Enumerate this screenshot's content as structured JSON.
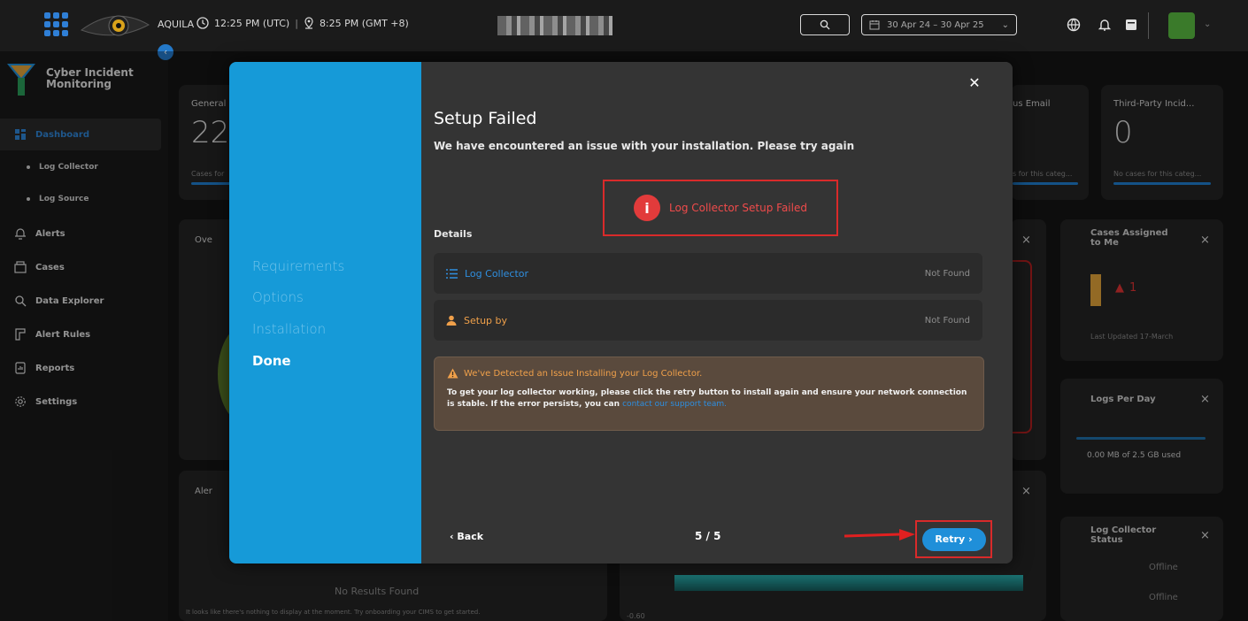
{
  "topbar": {
    "brand": "AQUILA",
    "time_utc": "12:25 PM (UTC)",
    "time_local": "8:25 PM (GMT +8)",
    "date_range": "30 Apr 24 – 30 Apr 25"
  },
  "sidebar": {
    "app_name_line1": "Cyber Incident",
    "app_name_line2": "Monitoring",
    "items": [
      {
        "label": "Dashboard"
      },
      {
        "label": "Log Collector"
      },
      {
        "label": "Log Source"
      },
      {
        "label": "Alerts"
      },
      {
        "label": "Cases"
      },
      {
        "label": "Data Explorer"
      },
      {
        "label": "Alert Rules"
      },
      {
        "label": "Reports"
      },
      {
        "label": "Settings"
      }
    ]
  },
  "dashboard": {
    "general_title": "General",
    "general_value": "22",
    "general_caption": "Cases for",
    "email_title": "us Email",
    "email_caption": "s for this categ...",
    "third_party_title": "Third-Party Incid...",
    "third_party_value": "0",
    "third_party_caption": "No cases for this categ...",
    "overview_title": "Ove",
    "cases_assigned_title": "Cases Assigned to Me",
    "cases_assigned_value": "1",
    "cases_assigned_delta": "1",
    "last_updated": "Last Updated 17-March",
    "logs_per_day_title": "Logs Per Day",
    "logs_used": "0.00 MB of 2.5 GB used",
    "alerts_title": "Aler",
    "no_results": "No Results Found",
    "no_results_hint": "It looks like there's nothing to display at the moment. Try onboarding your CIMS to get started.",
    "axis_value": "-0.60",
    "log_collector_status_title": "Log Collector Status",
    "offline_1": "Offline",
    "offline_2": "Offline"
  },
  "modal": {
    "steps": [
      "Requirements",
      "Options",
      "Installation",
      "Done"
    ],
    "title": "Setup Failed",
    "subtitle": "We have encountered an issue with your installation. Please try again",
    "fail_message": "Log Collector Setup Failed",
    "details_label": "Details",
    "rows": [
      {
        "label": "Log Collector",
        "value": "Not Found"
      },
      {
        "label": "Setup by",
        "value": "Not Found"
      }
    ],
    "warning_title": "We've Detected an Issue Installing your Log Collector.",
    "warning_body": "To get your log collector working, please click the retry button to install again and ensure your network connection is stable. If the error persists, you can ",
    "warning_link": "contact our support team.",
    "back_label": "Back",
    "pager": "5 / 5",
    "retry_label": "Retry"
  },
  "colors": {
    "accent": "#1f8fd9",
    "modal_left": "#169ad8",
    "error": "#e23b3b",
    "warning": "#f0a04a"
  }
}
